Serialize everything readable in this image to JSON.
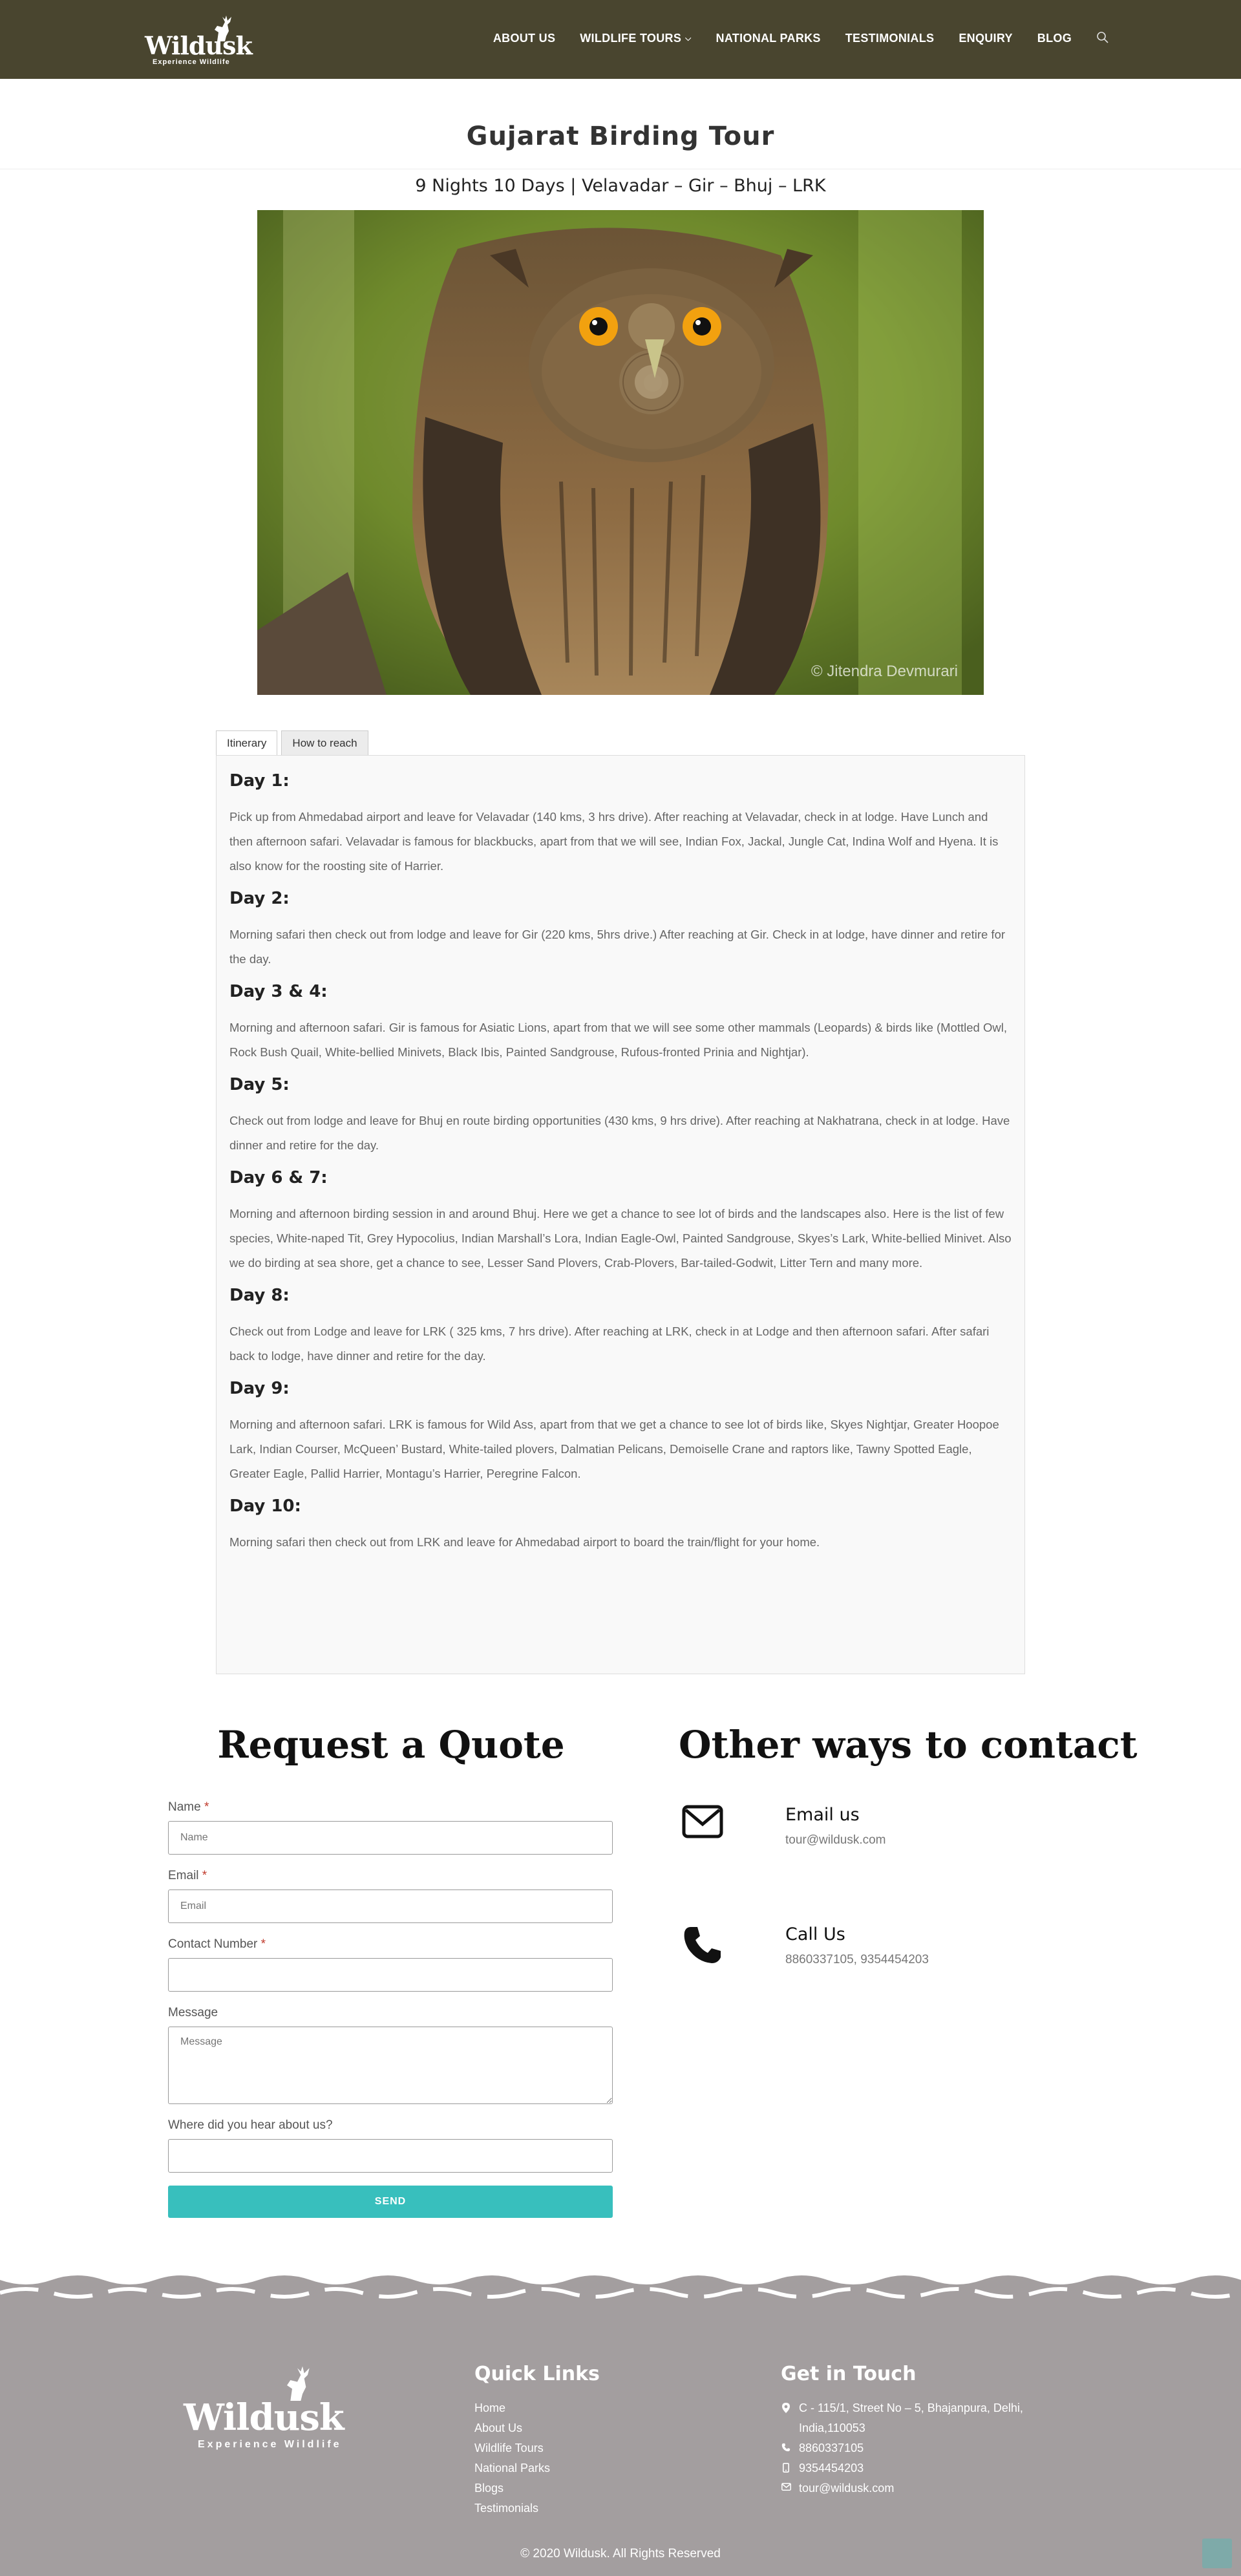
{
  "header": {
    "logo_text": "Wildusk",
    "logo_tagline": "Experience Wildlife",
    "nav": [
      {
        "label": "ABOUT US"
      },
      {
        "label": "WILDLIFE TOURS"
      },
      {
        "label": "NATIONAL PARKS"
      },
      {
        "label": "TESTIMONIALS"
      },
      {
        "label": "ENQUIRY"
      },
      {
        "label": "BLOG"
      }
    ]
  },
  "page": {
    "title": "Gujarat Birding Tour",
    "subtitle": "9 Nights 10 Days | Velavadar – Gir – Bhuj – LRK",
    "image_credit": "© Jitendra Devmurari"
  },
  "tabs": [
    {
      "label": "Itinerary"
    },
    {
      "label": "How to reach"
    }
  ],
  "itinerary": [
    {
      "title": "Day 1:",
      "text": "Pick up from Ahmedabad airport and leave for Velavadar (140 kms, 3 hrs drive). After reaching at Velavadar, check in at lodge. Have Lunch and then afternoon safari. Velavadar is famous for blackbucks, apart from that we will see, Indian Fox, Jackal, Jungle Cat, Indina Wolf and Hyena. It is also know for the roosting site of Harrier."
    },
    {
      "title": "Day 2:",
      "text": "Morning safari then check out from lodge and leave for Gir (220 kms, 5hrs drive.) After reaching at Gir. Check in at lodge, have dinner and retire for the day."
    },
    {
      "title": "Day 3 & 4:",
      "text": "Morning and afternoon safari. Gir is famous for Asiatic Lions, apart from that we will see some other mammals (Leopards) & birds like (Mottled Owl, Rock Bush Quail, White-bellied Minivets, Black Ibis, Painted Sandgrouse, Rufous-fronted Prinia and Nightjar)."
    },
    {
      "title": "Day 5:",
      "text": "Check out from lodge and leave for Bhuj en route birding opportunities  (430 kms, 9 hrs drive). After reaching at Nakhatrana, check in at lodge. Have dinner and retire for the day."
    },
    {
      "title": "Day 6 & 7:",
      "text": "Morning and afternoon birding session in and around Bhuj. Here we get a chance to see lot of birds and the landscapes also. Here is the list of few species, White-naped Tit, Grey Hypocolius, Indian Marshall’s Lora, Indian Eagle-Owl, Painted Sandgrouse, Skyes’s Lark, White-bellied Minivet. Also we do birding at sea shore, get a chance to see, Lesser Sand Plovers, Crab-Plovers, Bar-tailed-Godwit, Litter Tern and many more."
    },
    {
      "title": "Day 8:",
      "text": "Check out from Lodge and leave for LRK ( 325 kms, 7 hrs drive). After reaching at LRK, check in at Lodge and then afternoon safari. After safari back to lodge, have dinner and retire for the day."
    },
    {
      "title": "Day 9:",
      "text": "Morning and afternoon safari. LRK is famous for Wild Ass, apart from that we get a chance to see lot of birds like, Skyes Nightjar, Greater Hoopoe Lark, Indian Courser, McQueen’ Bustard, White-tailed plovers, Dalmatian Pelicans, Demoiselle Crane and raptors like, Tawny Spotted Eagle, Greater Eagle, Pallid Harrier, Montagu’s Harrier, Peregrine Falcon."
    },
    {
      "title": "Day 10:",
      "text": "Morning safari then check out from LRK and leave for Ahmedabad airport to board the train/flight for your home."
    }
  ],
  "quote": {
    "title": "Request a Quote",
    "name_label": "Name",
    "name_placeholder": "Name",
    "email_label": "Email",
    "email_placeholder": "Email",
    "phone_label": "Contact Number",
    "message_label": "Message",
    "message_placeholder": "Message",
    "source_label": "Where did you hear about us?",
    "required_mark": "*",
    "send_label": "SEND"
  },
  "contact": {
    "title": "Other ways to contact",
    "email_heading": "Email us",
    "email_value": "tour@wildusk.com",
    "call_heading": "Call Us",
    "call_value": "8860337105, 9354454203"
  },
  "footer": {
    "logo_text": "Wildusk",
    "logo_tagline": "Experience Wildlife",
    "quick_links_title": "Quick Links",
    "quick_links": [
      "Home",
      "About Us",
      "Wildlife Tours",
      "National Parks",
      "Blogs",
      "Testimonials"
    ],
    "touch_title": "Get in Touch",
    "address": "C - 115/1, Street No – 5, Bhajanpura, Delhi, India,110053",
    "phone1": "8860337105",
    "phone2": "9354454203",
    "email": "tour@wildusk.com",
    "copyright": "© 2020 Wildusk. All Rights Reserved"
  },
  "colors": {
    "header_bg": "#49452f",
    "accent": "#38bfbd",
    "footer_bg": "#a39e9f"
  }
}
